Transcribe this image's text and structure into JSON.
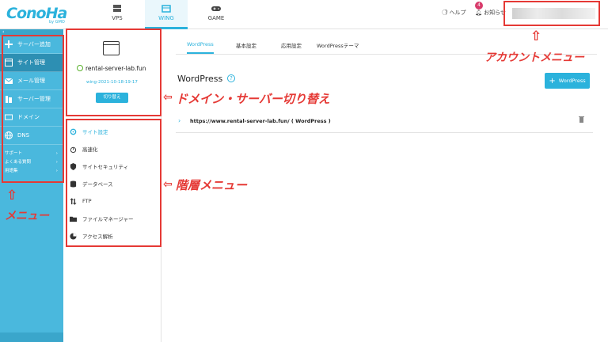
{
  "header": {
    "logo": "ConoHa",
    "logo_sub": "by GMO",
    "tabs": [
      "VPS",
      "WING",
      "GAME"
    ],
    "help": "ヘルプ",
    "notice": "お知らせ",
    "notice_count": "4"
  },
  "sidebar": {
    "collapse": "‹",
    "items": [
      "サーバー追加",
      "サイト管理",
      "メール管理",
      "サーバー管理",
      "ドメイン",
      "DNS"
    ],
    "links": [
      "サポート",
      "よくある質問",
      "用語集"
    ]
  },
  "subpanel": {
    "domain": "rental-server-lab.fun",
    "wing_id": "wing-2021-10-18-19-17",
    "switch_label": "切り替え",
    "menu": [
      "サイト設定",
      "高速化",
      "サイトセキュリティ",
      "データベース",
      "FTP",
      "ファイルマネージャー",
      "アクセス解析"
    ]
  },
  "main": {
    "tabs": [
      "WordPress",
      "基本設定",
      "応用設定",
      "WordPressテーマ"
    ],
    "title": "WordPress",
    "add_label": "WordPress",
    "row_url": "https://www.rental-server-lab.fun/ ( WordPress )"
  },
  "annotations": {
    "account_menu": "アカウントメニュー",
    "domain_switch": "ドメイン・サーバー切り替え",
    "hier_menu": "階層メニュー",
    "menu": "メニュー",
    "arrow_up": "⇧",
    "arrow_left": "⇦"
  },
  "colors": {
    "accent": "#2bb2dc",
    "sidebar": "#4ab8dd",
    "annotation": "#e53935"
  }
}
